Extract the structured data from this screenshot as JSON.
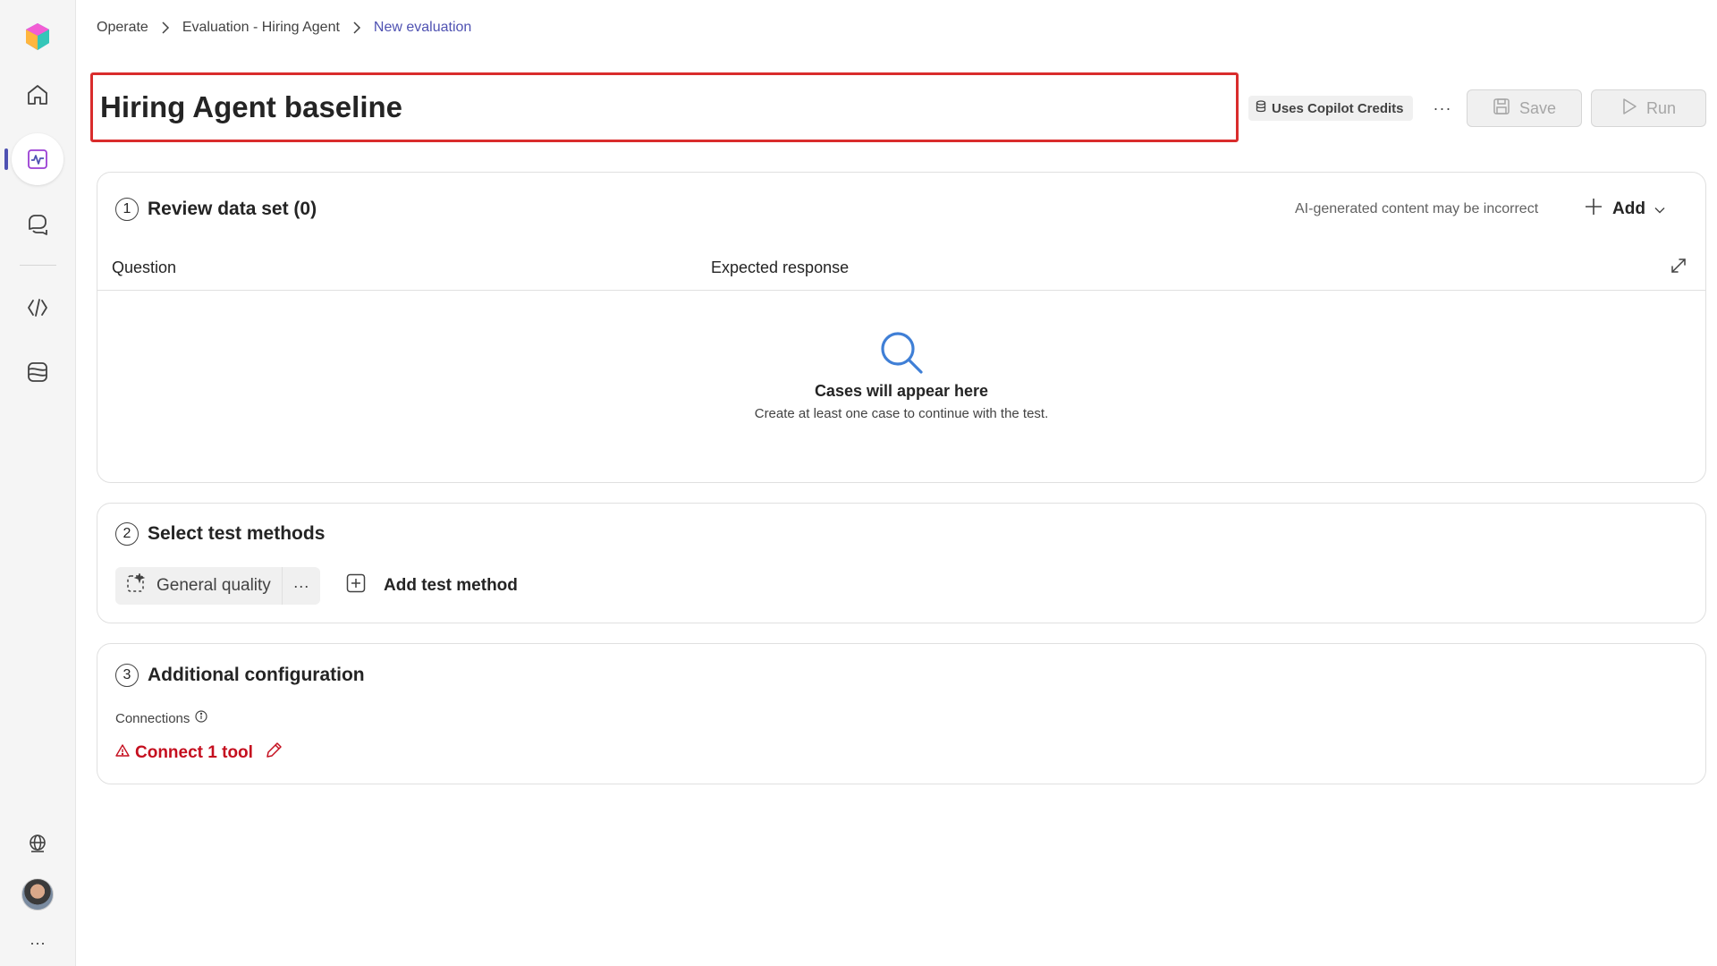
{
  "breadcrumb": {
    "items": [
      "Operate",
      "Evaluation - Hiring Agent"
    ],
    "current": "New evaluation"
  },
  "title": "Hiring Agent baseline",
  "toolbar": {
    "credits_label": "Uses Copilot Credits",
    "more_label": "···",
    "save_label": "Save",
    "run_label": "Run"
  },
  "section1": {
    "number": "1",
    "title": "Review data set (0)",
    "ai_note": "AI-generated content may be incorrect",
    "add_label": "Add",
    "columns": [
      "Question",
      "Expected response"
    ],
    "empty_title": "Cases will appear here",
    "empty_subtitle": "Create at least one case to continue with the test."
  },
  "section2": {
    "number": "2",
    "title": "Select test methods",
    "method_label": "General quality",
    "method_more": "···",
    "add_method_label": "Add test method"
  },
  "section3": {
    "number": "3",
    "title": "Additional configuration",
    "connections_label": "Connections",
    "connect_link": "Connect 1 tool"
  },
  "rail": {
    "more_label": "···"
  },
  "colors": {
    "accent": "#4f52b2",
    "title_highlight": "#d92c2c",
    "warning": "#c50f1f"
  }
}
